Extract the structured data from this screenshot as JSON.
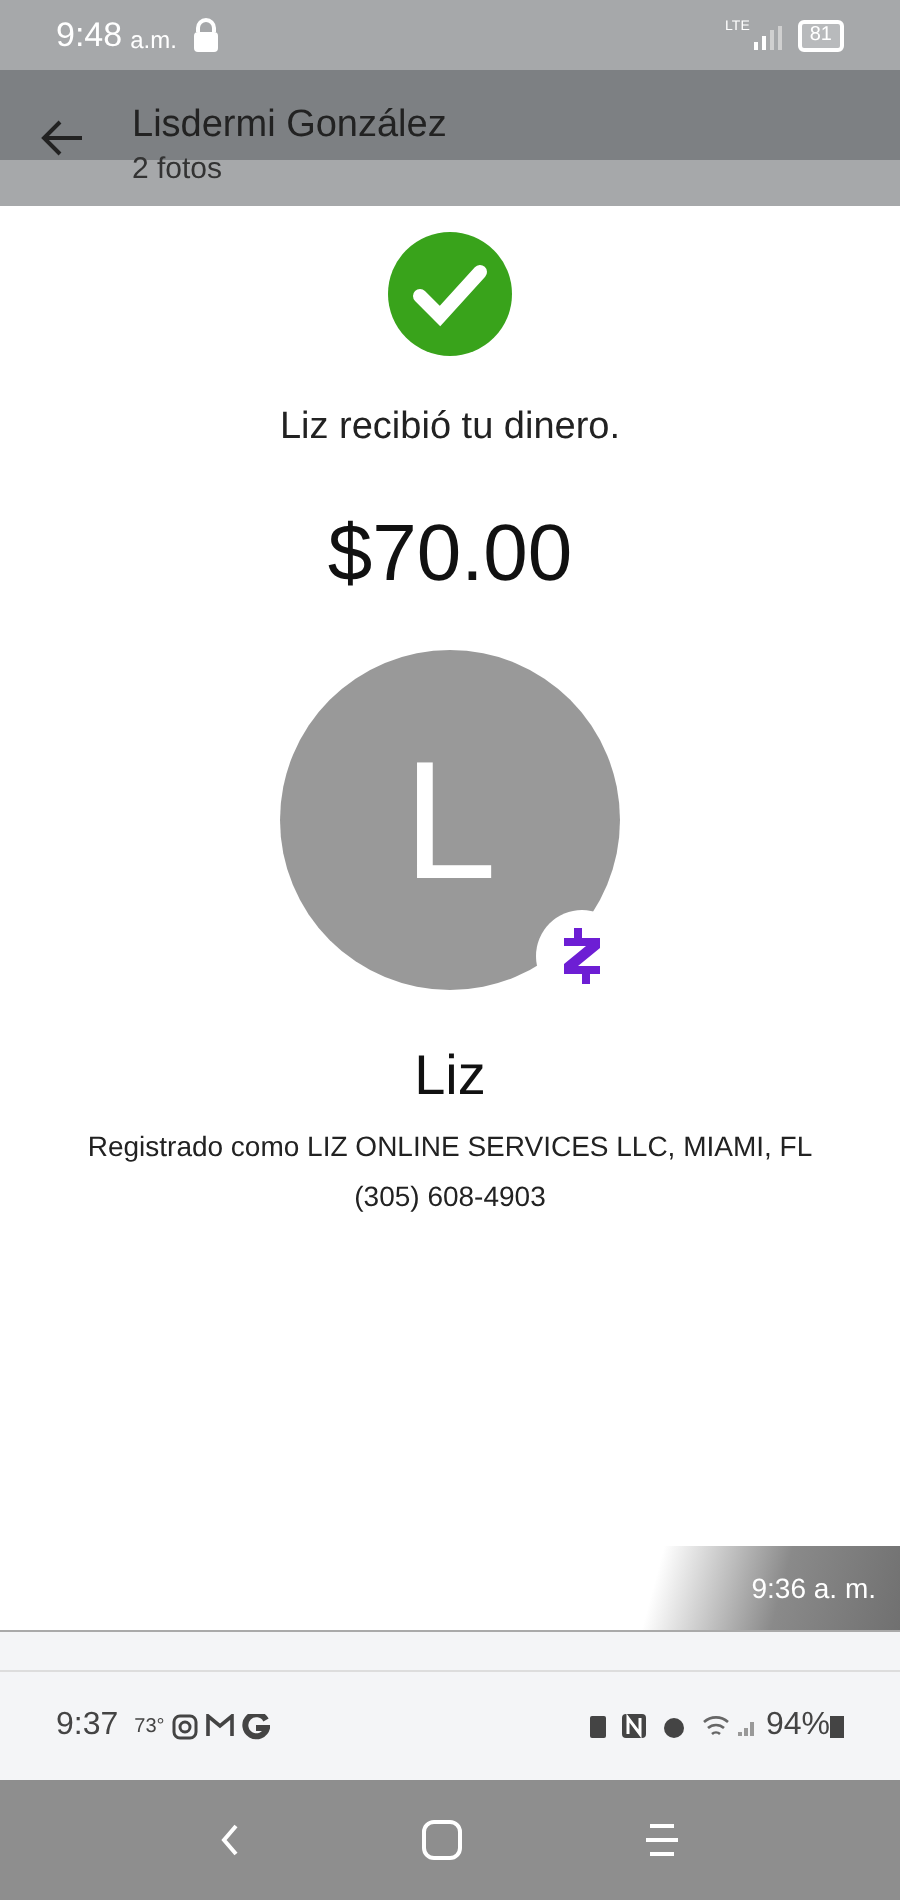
{
  "status_bar": {
    "time": "9:48",
    "ampm": "a.m.",
    "network": "LTE",
    "battery": "81"
  },
  "header": {
    "title": "Lisdermi González",
    "subtitle": "2 fotos"
  },
  "photo": {
    "message": "Liz recibió tu dinero.",
    "amount": "$70.00",
    "avatar_letter": "L",
    "name": "Liz",
    "registered": "Registrado como LIZ ONLINE SERVICES LLC, MIAMI, FL",
    "phone": "(305) 608-4903",
    "timestamp": "9:36 a. m.",
    "inner_status_bar": {
      "time": "9:37",
      "temperature": "73°",
      "battery": "94%"
    }
  }
}
